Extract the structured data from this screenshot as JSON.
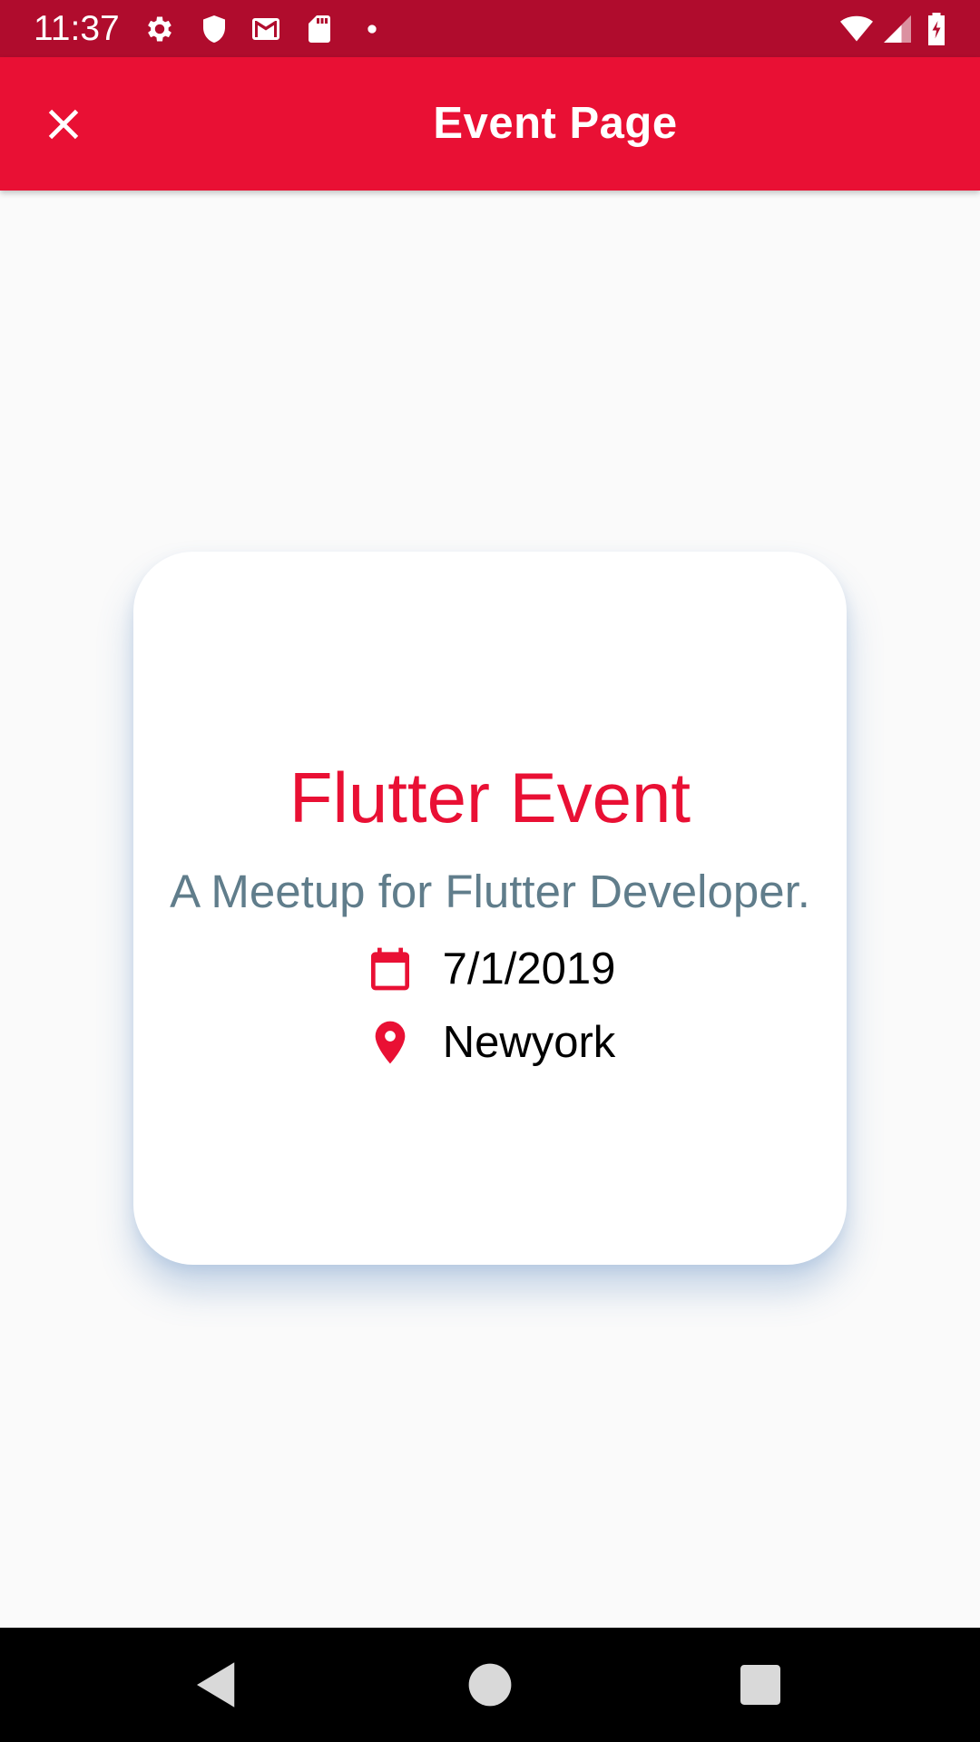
{
  "status_bar": {
    "time": "11:37",
    "icons": [
      "settings-icon",
      "shield-icon",
      "gmail-icon",
      "sd-card-icon",
      "dot-icon",
      "wifi-icon",
      "signal-icon",
      "battery-charging-icon"
    ]
  },
  "app_bar": {
    "title": "Event Page",
    "close_icon": "close-icon"
  },
  "event": {
    "title": "Flutter Event",
    "subtitle": "A Meetup for Flutter Developer.",
    "date": "7/1/2019",
    "location": "Newyork",
    "date_icon": "calendar-icon",
    "location_icon": "location-pin-icon"
  },
  "nav_bar": {
    "icons": [
      "back-icon",
      "home-icon",
      "recents-icon"
    ]
  },
  "colors": {
    "status_bar": "#b00c2d",
    "app_bar": "#e91034",
    "accent": "#e91034",
    "subtitle": "#607d8b",
    "background": "#fafafa",
    "card": "#ffffff"
  }
}
